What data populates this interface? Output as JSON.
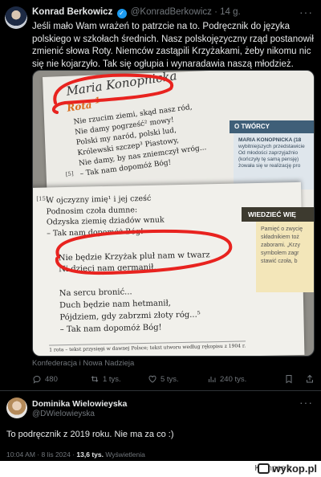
{
  "tweet1": {
    "author_name": "Konrad Berkowicz",
    "verified_badge": "✓",
    "handle": "@KonradBerkowicz",
    "time": "· 14 g.",
    "more": "···",
    "text": "Jeśli mało Wam wrażeń to patrzcie na to. Podręcznik do języka polskiego w szkołach średnich. Nasz polskojęzyczny rząd postanowił zmienić słowa Roty. Niemców zastąpili Krzyżakami, żeby nikomu nic się nie kojarzyło. Tak się ogłupia i wynaradawia naszą młodzież.",
    "media_caption": "Konfederacja i Nowa Nadzieja",
    "actions": {
      "replies": "480",
      "reposts": "1 tys.",
      "likes": "5 tys.",
      "views": "240 tys."
    },
    "icons": [
      "reply-icon",
      "repost-icon",
      "like-icon",
      "views-icon",
      "bookmark-icon",
      "share-icon"
    ]
  },
  "book": {
    "author_title": "Maria Konopnicka",
    "poem_title": "Rota",
    "footnote_mark": "1",
    "stanza1": [
      "Nie rzucim ziemi, skąd nasz ród,",
      "Nie damy pogrześć² mowy!",
      "Polski my naród, polski lud,",
      "Królewski szczep³ Piastowy,",
      "Nie damy, by nas zniemczył wróg...",
      "– Tak nam dopomóż Bóg!"
    ],
    "line_number_5": "[5]",
    "o_tworcy_header": "O TWÓRCY",
    "o_tworcy_name": "MARIA KONOPNICKA (18",
    "o_tworcy_lines": [
      "wybitniejszych przedstawicie",
      "Od młodości zaprzyjaźnio",
      "(kończyły tę samą pensję)",
      "żowała się w realizację pro"
    ],
    "line_number_15": "[15]",
    "stanza2": [
      "W ojczyzny imię¹ i jej cześć",
      "Podnosim czoła dumne:",
      "Odzyska ziemię dziadów wnuk",
      "– Tak nam dopomóż Bóg!"
    ],
    "stanza3": [
      "Nie będzie Krzyżak pluł nam w twarz",
      "Ni dzieci nam germanił."
    ],
    "stanza4": [
      "Na sercu bronić...",
      "Duch będzie nam hetmanił,",
      "Pójdziem, gdy zabrzmi złoty róg...⁵",
      "– Tak nam dopomóż Bóg!"
    ],
    "wiedziec_header": "WIEDZIEĆ WIĘ",
    "pamiec_lines": [
      "Pamięć o zwycię",
      "składnikiem toż",
      "zaborami. „Krzy",
      "symbolem zagr",
      "stawić czoła, b"
    ],
    "footnote": "1 rota – tekst przysięgi w dawnej Polsce; tekst utworu według rękopisu z 1904 r."
  },
  "tweet2": {
    "author_name": "Dominika Wielowieyska",
    "handle": "@DWielowieyska",
    "more": "···",
    "text": "To podręcznik z 2019 roku. Nie ma za co :)",
    "time": "10:04 AM · 8 lis 2024 ·",
    "views_count": "13,6 tys.",
    "views_label": "Wyświetlenia"
  },
  "footer": {
    "credit": "Kempes z",
    "site": "wykop.pl"
  },
  "colors": {
    "background": "#000000",
    "text": "#e7e9ea",
    "muted": "#71767b",
    "verified": "#1d9bf0",
    "annotation_red": "#e8231f",
    "rota_orange": "#d96b1b"
  }
}
